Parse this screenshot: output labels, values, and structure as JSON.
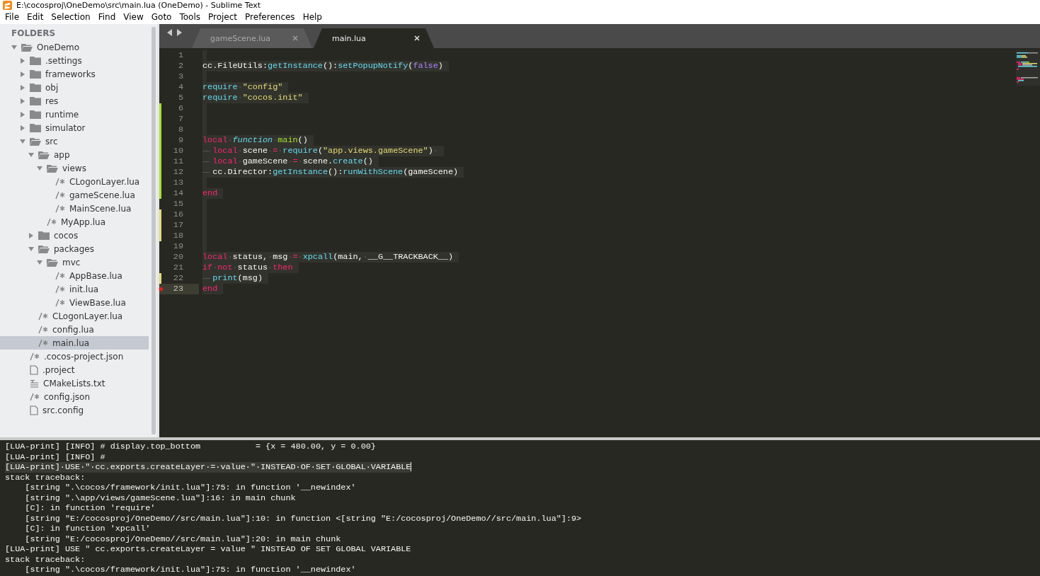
{
  "window": {
    "title": "E:\\cocosproj\\OneDemo\\src\\main.lua (OneDemo) - Sublime Text"
  },
  "menu": [
    "File",
    "Edit",
    "Selection",
    "Find",
    "View",
    "Goto",
    "Tools",
    "Project",
    "Preferences",
    "Help"
  ],
  "sidebar": {
    "heading": "FOLDERS",
    "tree": [
      {
        "label": "OneDemo",
        "kind": "folder",
        "expanded": true,
        "selected": false,
        "children": [
          {
            "label": ".settings",
            "kind": "folder",
            "expanded": false,
            "selected": false
          },
          {
            "label": "frameworks",
            "kind": "folder",
            "expanded": false,
            "selected": false
          },
          {
            "label": "obj",
            "kind": "folder",
            "expanded": false,
            "selected": false
          },
          {
            "label": "res",
            "kind": "folder",
            "expanded": false,
            "selected": false
          },
          {
            "label": "runtime",
            "kind": "folder",
            "expanded": false,
            "selected": false
          },
          {
            "label": "simulator",
            "kind": "folder",
            "expanded": false,
            "selected": false
          },
          {
            "label": "src",
            "kind": "folder",
            "expanded": true,
            "selected": false,
            "children": [
              {
                "label": "app",
                "kind": "folder",
                "expanded": true,
                "selected": false,
                "children": [
                  {
                    "label": "views",
                    "kind": "folder",
                    "expanded": true,
                    "selected": false,
                    "children": [
                      {
                        "label": "CLogonLayer.lua",
                        "kind": "code_file",
                        "selected": false
                      },
                      {
                        "label": "gameScene.lua",
                        "kind": "code_file",
                        "selected": false
                      },
                      {
                        "label": "MainScene.lua",
                        "kind": "code_file",
                        "selected": false
                      }
                    ]
                  },
                  {
                    "label": "MyApp.lua",
                    "kind": "code_file",
                    "selected": false
                  }
                ]
              },
              {
                "label": "cocos",
                "kind": "folder",
                "expanded": false,
                "selected": false
              },
              {
                "label": "packages",
                "kind": "folder",
                "expanded": true,
                "selected": false,
                "children": [
                  {
                    "label": "mvc",
                    "kind": "folder",
                    "expanded": true,
                    "selected": false,
                    "children": [
                      {
                        "label": "AppBase.lua",
                        "kind": "code_file",
                        "selected": false
                      },
                      {
                        "label": "init.lua",
                        "kind": "code_file",
                        "selected": false
                      },
                      {
                        "label": "ViewBase.lua",
                        "kind": "code_file",
                        "selected": false
                      }
                    ]
                  }
                ]
              },
              {
                "label": "CLogonLayer.lua",
                "kind": "code_file",
                "selected": false
              },
              {
                "label": "config.lua",
                "kind": "code_file",
                "selected": false
              },
              {
                "label": "main.lua",
                "kind": "code_file",
                "selected": true
              }
            ]
          },
          {
            "label": ".cocos-project.json",
            "kind": "code_file",
            "selected": false
          },
          {
            "label": ".project",
            "kind": "document",
            "selected": false
          },
          {
            "label": "CMakeLists.txt",
            "kind": "text_file",
            "selected": false
          },
          {
            "label": "config.json",
            "kind": "code_file",
            "selected": false
          },
          {
            "label": "src.config",
            "kind": "document",
            "selected": false
          }
        ]
      }
    ]
  },
  "tabs": [
    {
      "label": "gameScene.lua",
      "selected": false
    },
    {
      "label": "main.lua",
      "selected": true
    }
  ],
  "editor": {
    "lines": [
      {
        "number": "1",
        "added": false,
        "modified": false,
        "current": false
      },
      {
        "number": "2",
        "added": false,
        "modified": false,
        "current": false,
        "tokens": [
          {
            "kind": "plain",
            "text": "cc.FileUtils:"
          },
          {
            "kind": "support",
            "text": "getInstance"
          },
          {
            "kind": "plain",
            "text": "():"
          },
          {
            "kind": "support",
            "text": "setPopupNotify"
          },
          {
            "kind": "plain",
            "text": "("
          },
          {
            "kind": "constant",
            "text": "false"
          },
          {
            "kind": "plain",
            "text": ")"
          }
        ]
      },
      {
        "number": "3",
        "added": false,
        "modified": false,
        "current": false
      },
      {
        "number": "4",
        "added": false,
        "modified": false,
        "current": false,
        "tokens": [
          {
            "kind": "support",
            "text": "require"
          },
          {
            "kind": "space",
            "text": "·"
          },
          {
            "kind": "string",
            "text": "\"config\""
          }
        ]
      },
      {
        "number": "5",
        "added": false,
        "modified": false,
        "current": false,
        "tokens": [
          {
            "kind": "support",
            "text": "require"
          },
          {
            "kind": "space",
            "text": "·"
          },
          {
            "kind": "string",
            "text": "\"cocos.init\""
          }
        ]
      },
      {
        "number": "6",
        "added": true,
        "modified": false,
        "current": false
      },
      {
        "number": "7",
        "added": true,
        "modified": false,
        "current": false
      },
      {
        "number": "8",
        "added": true,
        "modified": false,
        "current": false
      },
      {
        "number": "9",
        "added": true,
        "modified": false,
        "current": false,
        "tokens": [
          {
            "kind": "keyword",
            "text": "local"
          },
          {
            "kind": "space",
            "text": "·"
          },
          {
            "kind": "storage",
            "text": "function"
          },
          {
            "kind": "space",
            "text": "·"
          },
          {
            "kind": "entity",
            "text": "main"
          },
          {
            "kind": "plain",
            "text": "()"
          }
        ]
      },
      {
        "number": "10",
        "added": true,
        "modified": false,
        "current": false,
        "tokens": [
          {
            "kind": "tab",
            "text": "——"
          },
          {
            "kind": "keyword",
            "text": "local"
          },
          {
            "kind": "space",
            "text": "·"
          },
          {
            "kind": "plain",
            "text": "scene"
          },
          {
            "kind": "space",
            "text": "·"
          },
          {
            "kind": "keyword",
            "text": "="
          },
          {
            "kind": "space",
            "text": "·"
          },
          {
            "kind": "support",
            "text": "require"
          },
          {
            "kind": "plain",
            "text": "("
          },
          {
            "kind": "string",
            "text": "\"app.views.gameScene\""
          },
          {
            "kind": "plain",
            "text": ")"
          },
          {
            "kind": "space",
            "text": "·"
          }
        ]
      },
      {
        "number": "11",
        "added": true,
        "modified": false,
        "current": false,
        "tokens": [
          {
            "kind": "tab",
            "text": "——"
          },
          {
            "kind": "keyword",
            "text": "local"
          },
          {
            "kind": "space",
            "text": "·"
          },
          {
            "kind": "plain",
            "text": "gameScene"
          },
          {
            "kind": "space",
            "text": "·"
          },
          {
            "kind": "keyword",
            "text": "="
          },
          {
            "kind": "space",
            "text": "·"
          },
          {
            "kind": "plain",
            "text": "scene."
          },
          {
            "kind": "support",
            "text": "create"
          },
          {
            "kind": "plain",
            "text": "()"
          }
        ]
      },
      {
        "number": "12",
        "added": true,
        "modified": false,
        "current": false,
        "tokens": [
          {
            "kind": "tab",
            "text": "——"
          },
          {
            "kind": "plain",
            "text": "cc.Director:"
          },
          {
            "kind": "support",
            "text": "getInstance"
          },
          {
            "kind": "plain",
            "text": "():"
          },
          {
            "kind": "support",
            "text": "runWithScene"
          },
          {
            "kind": "plain",
            "text": "(gameScene)"
          }
        ]
      },
      {
        "number": "13",
        "added": true,
        "modified": false,
        "current": false
      },
      {
        "number": "14",
        "added": true,
        "modified": false,
        "current": false,
        "tokens": [
          {
            "kind": "keyword",
            "text": "end"
          }
        ]
      },
      {
        "number": "15",
        "added": false,
        "modified": false,
        "current": false
      },
      {
        "number": "16",
        "added": false,
        "modified": true,
        "current": false
      },
      {
        "number": "17",
        "added": false,
        "modified": true,
        "current": false
      },
      {
        "number": "18",
        "added": false,
        "modified": true,
        "current": false
      },
      {
        "number": "19",
        "added": false,
        "modified": false,
        "current": false
      },
      {
        "number": "20",
        "added": false,
        "modified": false,
        "current": false,
        "tokens": [
          {
            "kind": "keyword",
            "text": "local"
          },
          {
            "kind": "space",
            "text": "·"
          },
          {
            "kind": "plain",
            "text": "status,"
          },
          {
            "kind": "space",
            "text": "·"
          },
          {
            "kind": "plain",
            "text": "msg"
          },
          {
            "kind": "space",
            "text": "·"
          },
          {
            "kind": "keyword",
            "text": "="
          },
          {
            "kind": "space",
            "text": "·"
          },
          {
            "kind": "support",
            "text": "xpcall"
          },
          {
            "kind": "plain",
            "text": "(main,"
          },
          {
            "kind": "space",
            "text": "·"
          },
          {
            "kind": "plain",
            "text": "__G__TRACKBACK__)"
          }
        ]
      },
      {
        "number": "21",
        "added": false,
        "modified": false,
        "current": false,
        "tokens": [
          {
            "kind": "keyword",
            "text": "if"
          },
          {
            "kind": "space",
            "text": "·"
          },
          {
            "kind": "keyword",
            "text": "not"
          },
          {
            "kind": "space",
            "text": "·"
          },
          {
            "kind": "plain",
            "text": "status"
          },
          {
            "kind": "space",
            "text": "·"
          },
          {
            "kind": "keyword",
            "text": "then"
          }
        ]
      },
      {
        "number": "22",
        "added": false,
        "modified": true,
        "current": false,
        "tokens": [
          {
            "kind": "tab",
            "text": "——"
          },
          {
            "kind": "support",
            "text": "print"
          },
          {
            "kind": "plain",
            "text": "(msg)"
          }
        ]
      },
      {
        "number": "23",
        "added": false,
        "modified": false,
        "current": true,
        "tokens": [
          {
            "kind": "keyword",
            "text": "end"
          }
        ]
      }
    ]
  },
  "console": {
    "lines": [
      {
        "text": "[LUA-print] [INFO] # display.top_bottom           = {x = 480.00, y = 0.00}",
        "selected": false
      },
      {
        "text": "[LUA-print] [INFO] #",
        "selected": false
      },
      {
        "text": "[LUA-print]·USE·\"·cc.exports.createLayer·=·value·\"·INSTEAD·OF·SET·GLOBAL·VARIABLE",
        "selected": true
      },
      {
        "text": "stack traceback:",
        "selected": false
      },
      {
        "text": "    [string \".\\cocos/framework/init.lua\"]:75: in function '__newindex'",
        "selected": false
      },
      {
        "text": "    [string \".\\app/views/gameScene.lua\"]:16: in main chunk",
        "selected": false
      },
      {
        "text": "    [C]: in function 'require'",
        "selected": false
      },
      {
        "text": "    [string \"E:/cocosproj/OneDemo//src/main.lua\"]:10: in function <[string \"E:/cocosproj/OneDemo//src/main.lua\"]:9>",
        "selected": false
      },
      {
        "text": "    [C]: in function 'xpcall'",
        "selected": false
      },
      {
        "text": "    [string \"E:/cocosproj/OneDemo//src/main.lua\"]:20: in main chunk",
        "selected": false
      },
      {
        "text": "[LUA-print] USE \" cc.exports.createLayer = value \" INSTEAD OF SET GLOBAL VARIABLE",
        "selected": false
      },
      {
        "text": "stack traceback:",
        "selected": false
      },
      {
        "text": "    [string \".\\cocos/framework/init.lua\"]:75: in function '__newindex'",
        "selected": false
      }
    ]
  }
}
